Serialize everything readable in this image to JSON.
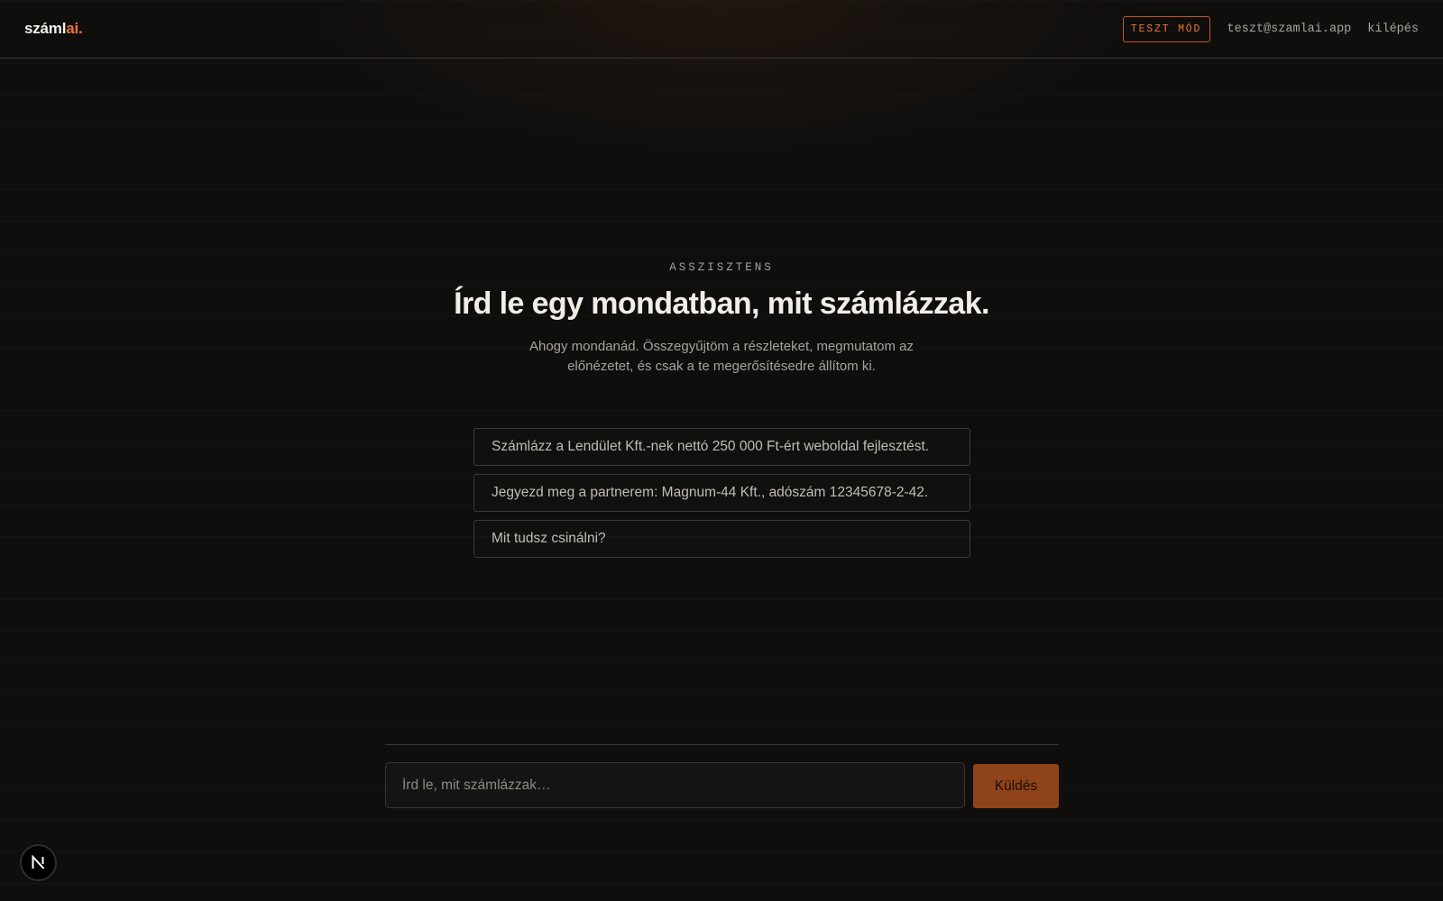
{
  "header": {
    "logo_main": "száml",
    "logo_accent": "ai.",
    "test_mode_label": "TESZT MÓD",
    "user_email": "teszt@szamlai.app",
    "logout_label": "kilépés"
  },
  "hero": {
    "eyebrow": "ASSZISZTENS",
    "title": "Írd le egy mondatban, mit számlázzak.",
    "subtitle": "Ahogy mondanád. Összegyűjtöm a részleteket, megmutatom az előnézetet, és csak a te megerősítésedre állítom ki."
  },
  "suggestions": [
    "Számlázz a Lendület Kft.-nek nettó 250 000 Ft-ért weboldal fejlesztést.",
    "Jegyezd meg a partnerem: Magnum-44 Kft., adószám 12345678-2-42.",
    "Mit tudsz csinálni?"
  ],
  "composer": {
    "placeholder": "Írd le, mit számlázzak…",
    "value": "",
    "send_label": "Küldés"
  },
  "colors": {
    "background": "#0f0e0d",
    "accent": "#e8743b",
    "send_button": "#8f4318"
  },
  "icons": {
    "dev_badge": "nextjs-logo-icon"
  }
}
